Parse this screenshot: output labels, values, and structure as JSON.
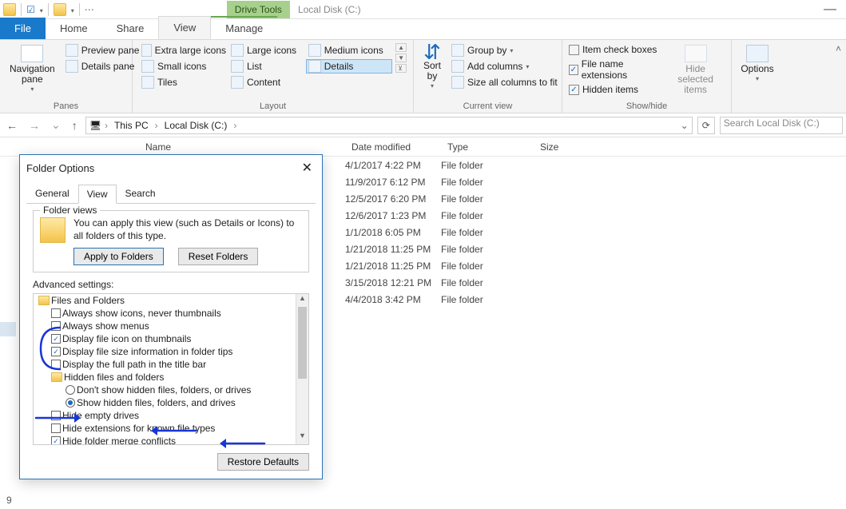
{
  "window": {
    "title_path": "Local Disk (C:)",
    "drive_tools": "Drive Tools"
  },
  "tabs": {
    "file": "File",
    "home": "Home",
    "share": "Share",
    "view": "View",
    "manage": "Manage"
  },
  "ribbon": {
    "panes": {
      "nav": "Navigation\npane",
      "preview": "Preview pane",
      "details": "Details pane",
      "label": "Panes"
    },
    "layout": {
      "xl": "Extra large icons",
      "lg": "Large icons",
      "md": "Medium icons",
      "sm": "Small icons",
      "list": "List",
      "details": "Details",
      "tiles": "Tiles",
      "content": "Content",
      "label": "Layout"
    },
    "current": {
      "sort": "Sort\nby",
      "group": "Group by",
      "addcols": "Add columns",
      "fit": "Size all columns to fit",
      "label": "Current view"
    },
    "showhide": {
      "itemchk": "Item check boxes",
      "ext": "File name extensions",
      "hidden": "Hidden items",
      "hidesel": "Hide selected\nitems",
      "label": "Show/hide"
    },
    "options": "Options"
  },
  "addr": {
    "thispc": "This PC",
    "drive": "Local Disk (C:)",
    "search_placeholder": "Search Local Disk (C:)"
  },
  "columns": {
    "name": "Name",
    "date": "Date modified",
    "type": "Type",
    "size": "Size"
  },
  "rows": [
    {
      "date": "4/1/2017 4:22 PM",
      "type": "File folder"
    },
    {
      "date": "11/9/2017 6:12 PM",
      "type": "File folder"
    },
    {
      "date": "12/5/2017 6:20 PM",
      "type": "File folder"
    },
    {
      "date": "12/6/2017 1:23 PM",
      "type": "File folder"
    },
    {
      "date": "1/1/2018 6:05 PM",
      "type": "File folder"
    },
    {
      "date": "1/21/2018 11:25 PM",
      "type": "File folder"
    },
    {
      "date": "1/21/2018 11:25 PM",
      "type": "File folder"
    },
    {
      "date": "3/15/2018 12:21 PM",
      "type": "File folder"
    },
    {
      "date": "4/4/2018 3:42 PM",
      "type": "File folder"
    }
  ],
  "sidebar": {
    "count": "9"
  },
  "dialog": {
    "title": "Folder Options",
    "tabs": {
      "general": "General",
      "view": "View",
      "search": "Search"
    },
    "fv": {
      "legend": "Folder views",
      "text": "You can apply this view (such as Details or Icons) to all folders of this type.",
      "apply": "Apply to Folders",
      "reset": "Reset Folders"
    },
    "adv_label": "Advanced settings:",
    "tree": {
      "root": "Files and Folders",
      "always_icons": "Always show icons, never thumbnails",
      "always_menus": "Always show menus",
      "disp_icon_thumb": "Display file icon on thumbnails",
      "disp_size_tips": "Display file size information in folder tips",
      "disp_full_path": "Display the full path in the title bar",
      "hidden_group": "Hidden files and folders",
      "dont_show": "Don't show hidden files, folders, or drives",
      "show_hidden": "Show hidden files, folders, and drives",
      "hide_empty": "Hide empty drives",
      "hide_ext": "Hide extensions for known file types",
      "hide_merge": "Hide folder merge conflicts"
    },
    "restore": "Restore Defaults"
  }
}
